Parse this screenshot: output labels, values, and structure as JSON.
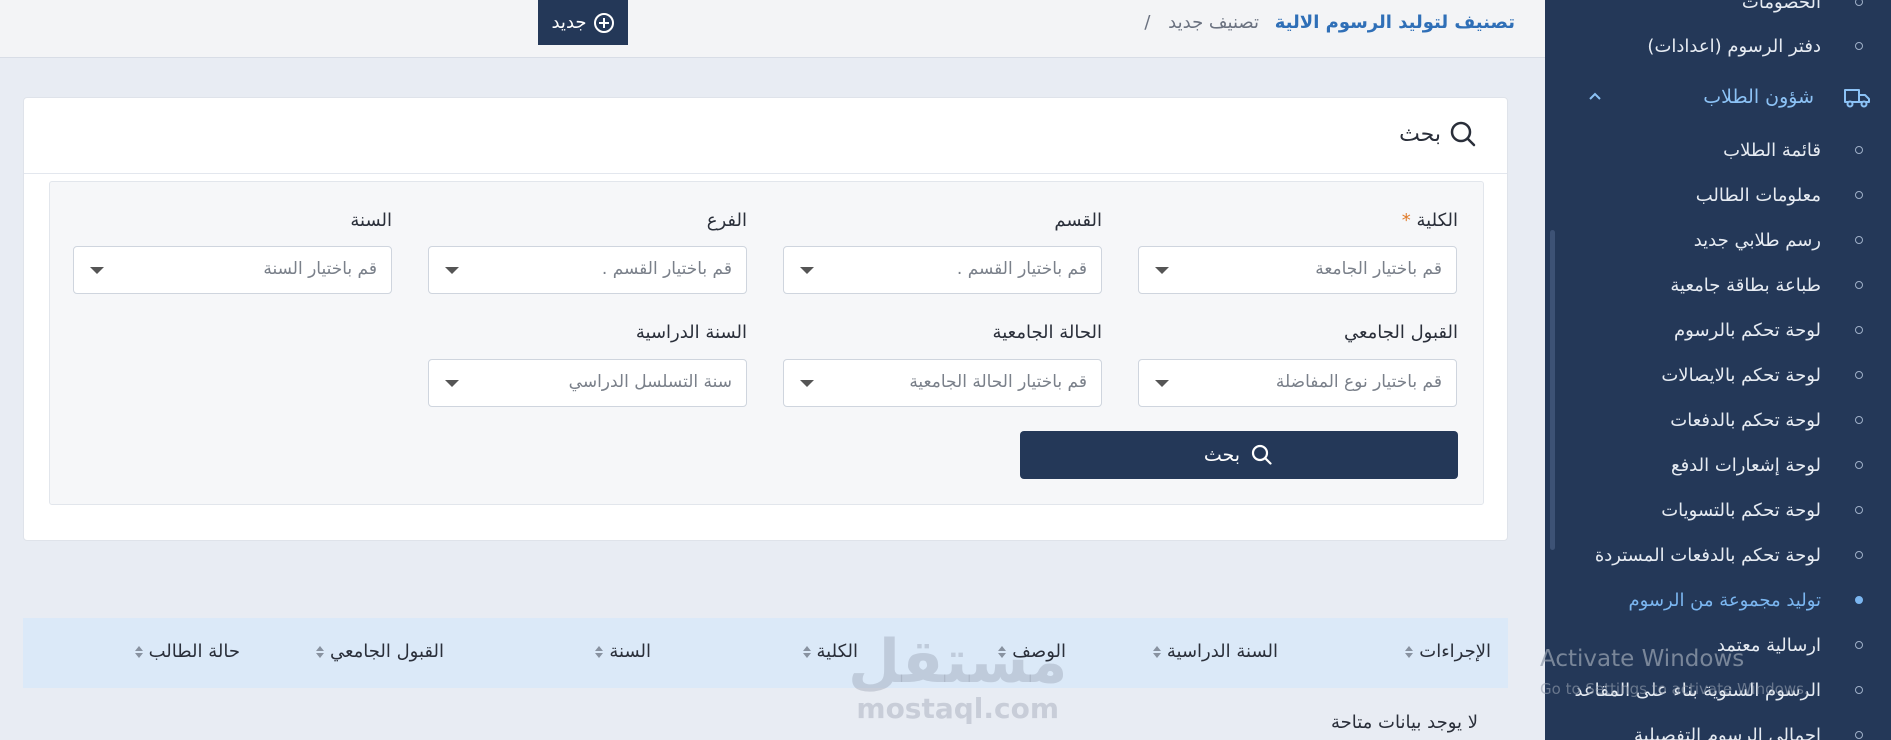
{
  "sidebar": {
    "items_top": [
      {
        "label": "الخصومات"
      },
      {
        "label": "دفتر الرسوم (اعدادات)"
      }
    ],
    "group": {
      "label": "شؤون الطلاب",
      "icon": "truck-icon"
    },
    "items": [
      {
        "label": "قائمة الطلاب",
        "active": false
      },
      {
        "label": "معلومات الطالب",
        "active": false
      },
      {
        "label": "رسم طلابي جديد",
        "active": false
      },
      {
        "label": "طباعة بطاقة جامعية",
        "active": false
      },
      {
        "label": "لوحة تحكم بالرسوم",
        "active": false
      },
      {
        "label": "لوحة تحكم بالايصالات",
        "active": false
      },
      {
        "label": "لوحة تحكم بالدفعات",
        "active": false
      },
      {
        "label": "لوحة إشعارات الدفع",
        "active": false
      },
      {
        "label": "لوحة تحكم بالتسويات",
        "active": false
      },
      {
        "label": "لوحة تحكم بالدفعات المستردة",
        "active": false
      },
      {
        "label": "توليد مجموعة من الرسوم",
        "active": true
      },
      {
        "label": "ارسالية معتمد",
        "active": false
      },
      {
        "label": "الرسوم السنوية بناء على المقاعد",
        "active": false
      },
      {
        "label": "اجمالي الرسوم التفصيلية",
        "active": false
      }
    ]
  },
  "header": {
    "breadcrumb_main": "تصنيف لتوليد الرسوم الالية",
    "breadcrumb_sub": "تصنيف جديد",
    "breadcrumb_sep": "/",
    "new_button": "جديد"
  },
  "search": {
    "title": "بحث",
    "fields": [
      {
        "label": "الكلية",
        "required": "*",
        "placeholder": "قم باختيار الجامعة"
      },
      {
        "label": "القسم",
        "required": "",
        "placeholder": "قم باختيار القسم ."
      },
      {
        "label": "الفرع",
        "required": "",
        "placeholder": "قم باختيار القسم ."
      },
      {
        "label": "السنة",
        "required": "",
        "placeholder": "قم باختيار السنة"
      },
      {
        "label": "القبول الجامعي",
        "required": "",
        "placeholder": "قم باختيار نوع المفاضلة"
      },
      {
        "label": "الحالة الجامعية",
        "required": "",
        "placeholder": "قم باختيار الحالة الجامعية"
      },
      {
        "label": "السنة الدراسية",
        "required": "",
        "placeholder": "سنة التسلسل الدراسي"
      }
    ],
    "button": "بحث"
  },
  "table": {
    "columns": [
      "الإجراءات",
      "السنة الدراسية",
      "الوصف",
      "الكلية",
      "السنة",
      "القبول الجامعي",
      "حالة الطالب"
    ],
    "empty": "لا يوجد بيانات متاحة"
  },
  "overlay": {
    "watermark_ar": "مستقل",
    "watermark_en": "mostaql.com",
    "activate_title": "Activate Windows",
    "activate_sub": "Go to Settings to activate Windows."
  },
  "colors": {
    "sidebar": "#243858",
    "accent": "#2f6fb7",
    "active": "#7bb6f0",
    "table_head": "#dbe9f8"
  }
}
